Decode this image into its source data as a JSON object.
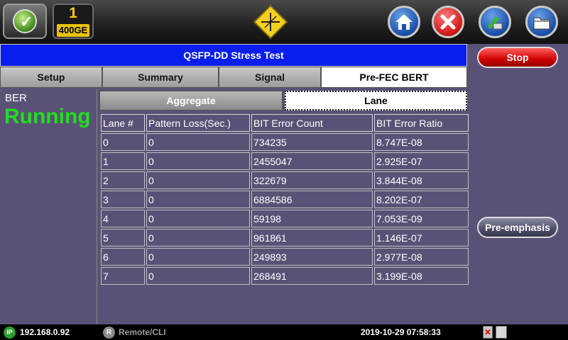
{
  "topbar": {
    "port_number": "1",
    "port_speed": "400GE",
    "icons": [
      "logo-icon",
      "warning-icon",
      "home-icon",
      "close-icon",
      "tools-icon",
      "folder-icon"
    ]
  },
  "header": {
    "title": "QSFP-DD Stress Test"
  },
  "tabs": [
    {
      "label": "Setup",
      "active": false
    },
    {
      "label": "Summary",
      "active": false
    },
    {
      "label": "Signal",
      "active": false
    },
    {
      "label": "Pre-FEC BERT",
      "active": true
    }
  ],
  "subtabs": [
    {
      "label": "Aggregate",
      "active": false
    },
    {
      "label": "Lane",
      "active": true
    }
  ],
  "status": {
    "label": "BER",
    "value": "Running",
    "color": "#22dd22"
  },
  "buttons": {
    "stop": "Stop",
    "preemphasis": "Pre-emphasis"
  },
  "table": {
    "headers": [
      "Lane #",
      "Pattern Loss(Sec.)",
      "BIT Error Count",
      "BIT Error Ratio"
    ],
    "rows": [
      [
        "0",
        "0",
        "734235",
        "8.747E-08"
      ],
      [
        "1",
        "0",
        "2455047",
        "2.925E-07"
      ],
      [
        "2",
        "0",
        "322679",
        "3.844E-08"
      ],
      [
        "3",
        "0",
        "6884586",
        "8.202E-07"
      ],
      [
        "4",
        "0",
        "59198",
        "7.053E-09"
      ],
      [
        "5",
        "0",
        "961861",
        "1.146E-07"
      ],
      [
        "6",
        "0",
        "249893",
        "2.977E-08"
      ],
      [
        "7",
        "0",
        "268491",
        "3.199E-08"
      ]
    ]
  },
  "statusbar": {
    "ip_badge": "IP",
    "ip": "192.168.0.92",
    "remote_badge": "R",
    "remote": "Remote/CLI",
    "datetime": "2019-10-29  07:58:33"
  },
  "colors": {
    "title_bar": "#0a1ef0",
    "panel_bg": "#5a5276",
    "stop_button": "#d00000",
    "running": "#22dd22"
  }
}
